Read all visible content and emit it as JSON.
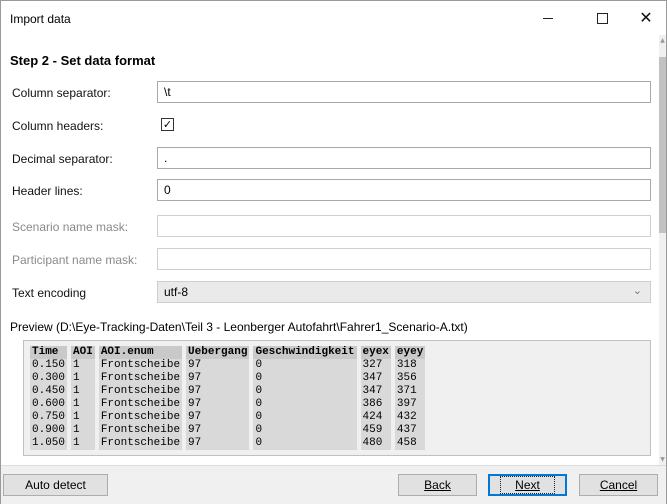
{
  "window": {
    "title": "Import data",
    "controls": {
      "minimize": "minimize-icon",
      "maximize": "maximize-icon",
      "close": "close-icon"
    }
  },
  "step_title": "Step 2 - Set data format",
  "fields": {
    "column_separator": {
      "label": "Column separator:",
      "value": "\\t"
    },
    "column_headers": {
      "label": "Column headers:",
      "checked": true
    },
    "decimal_separator": {
      "label": "Decimal separator:",
      "value": "."
    },
    "header_lines": {
      "label": "Header lines:",
      "value": "0"
    },
    "scenario_mask": {
      "label": "Scenario name mask:",
      "value": ""
    },
    "participant_mask": {
      "label": "Participant name mask:",
      "value": ""
    },
    "text_encoding": {
      "label": "Text encoding",
      "value": "utf-8"
    }
  },
  "preview": {
    "label": "Preview (D:\\Eye-Tracking-Daten\\Teil 3 - Leonberger Autofahrt\\Fahrer1_Scenario-A.txt)",
    "columns": [
      "Time",
      "AOI",
      "AOI.enum",
      "Uebergang",
      "Geschwindigkeit",
      "eyex",
      "eyey"
    ],
    "rows": [
      [
        "0.150",
        "1",
        "Frontscheibe",
        "97",
        "0",
        "327",
        "318"
      ],
      [
        "0.300",
        "1",
        "Frontscheibe",
        "97",
        "0",
        "347",
        "356"
      ],
      [
        "0.450",
        "1",
        "Frontscheibe",
        "97",
        "0",
        "347",
        "371"
      ],
      [
        "0.600",
        "1",
        "Frontscheibe",
        "97",
        "0",
        "386",
        "397"
      ],
      [
        "0.750",
        "1",
        "Frontscheibe",
        "97",
        "0",
        "424",
        "432"
      ],
      [
        "0.900",
        "1",
        "Frontscheibe",
        "97",
        "0",
        "459",
        "437"
      ],
      [
        "1.050",
        "1",
        "Frontscheibe",
        "97",
        "0",
        "480",
        "458"
      ]
    ]
  },
  "buttons": {
    "auto_detect": "Auto detect",
    "back": "Back",
    "next": "Next",
    "cancel": "Cancel"
  }
}
